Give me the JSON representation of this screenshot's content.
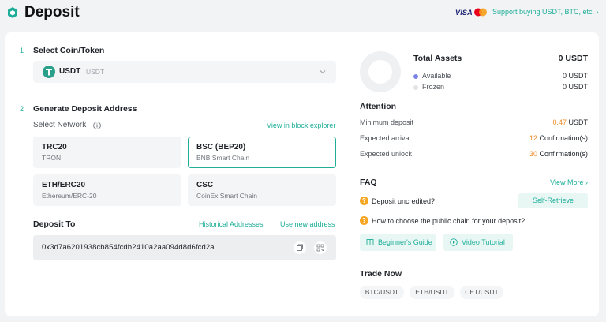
{
  "header": {
    "title": "Deposit",
    "visa": "VISA",
    "support_link": "Support buying USDT, BTC, etc. ›"
  },
  "steps": {
    "step1_num": "1",
    "step1_title": "Select Coin/Token",
    "step2_num": "2",
    "step2_title": "Generate Deposit Address"
  },
  "coin": {
    "name": "USDT",
    "sub": "USDT"
  },
  "network": {
    "label": "Select Network",
    "explorer_link": "View in block explorer",
    "options": [
      {
        "name": "TRC20",
        "sub": "TRON"
      },
      {
        "name": "BSC (BEP20)",
        "sub": "BNB Smart Chain"
      },
      {
        "name": "ETH/ERC20",
        "sub": "Ethereum/ERC-20"
      },
      {
        "name": "CSC",
        "sub": "CoinEx Smart Chain"
      }
    ],
    "selected": "BSC (BEP20)"
  },
  "deposit_to": {
    "label": "Deposit To",
    "history_link": "Historical Addresses",
    "new_link": "Use new address",
    "address": "0x3d7a6201938cb854fcdb2410a2aa094d8d6fcd2a"
  },
  "assets": {
    "title": "Total Assets",
    "total": "0 USDT",
    "available_label": "Available",
    "available_value": "0 USDT",
    "frozen_label": "Frozen",
    "frozen_value": "0 USDT"
  },
  "attention": {
    "title": "Attention",
    "min_label": "Minimum deposit",
    "min_value": "0.47",
    "min_unit": "USDT",
    "arrival_label": "Expected arrival",
    "arrival_value": "12",
    "arrival_unit": "Confirmation(s)",
    "unlock_label": "Expected unlock",
    "unlock_value": "30",
    "unlock_unit": "Confirmation(s)"
  },
  "faq": {
    "title": "FAQ",
    "view_more": "View More ›",
    "q1": "Deposit uncredited?",
    "self_retrieve": "Self-Retrieve",
    "q2": "How to choose the public chain for your deposit?",
    "beginners_guide": "Beginner's Guide",
    "video_tutorial": "Video Tutorial"
  },
  "trade": {
    "title": "Trade Now",
    "pairs": [
      "BTC/USDT",
      "ETH/USDT",
      "CET/USDT"
    ]
  },
  "colors": {
    "accent": "#1eae98",
    "orange": "#f08a24",
    "available_dot": "#7b83e8"
  }
}
